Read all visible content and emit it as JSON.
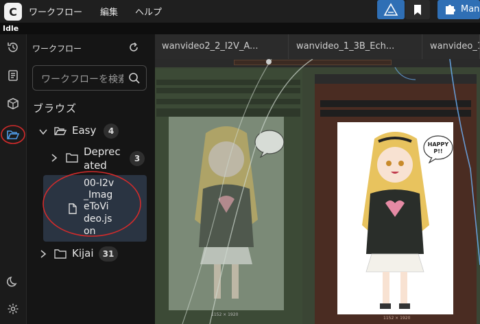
{
  "menu": {
    "workflow": "ワークフロー",
    "edit": "編集",
    "help": "ヘルプ"
  },
  "toolbar": {
    "manager_label": "Man"
  },
  "status": "Idle",
  "sidebar": {
    "title": "ワークフロー",
    "search_placeholder": "ワークフローを検索",
    "browse_heading": "ブラウズ",
    "tree": {
      "easy": {
        "label": "Easy",
        "count": "4"
      },
      "deprecated": {
        "label_line1": "Deprec",
        "label_line2": "ated",
        "count": "3"
      },
      "file": {
        "label": [
          "00-I2v",
          "_Imag",
          "eToVi",
          "deo.js",
          "on"
        ]
      },
      "kijai": {
        "label": "Kijai",
        "count": "31"
      }
    }
  },
  "tabs": [
    "wanvideo2_2_I2V_A...",
    "wanvideo_1_3B_Ech...",
    "wanvideo_1"
  ],
  "canvas": {
    "image_caption_left": "1152 × 1920",
    "image_caption_right": "1152 × 1920",
    "speech_bubble": "HAPPY\nP!!"
  },
  "colors": {
    "accent": "#2f6fb5",
    "annotation": "#d22b2b",
    "node_brown": "#4a2c22",
    "node_green": "#3c4a36"
  },
  "icons": [
    "history-icon",
    "queue-icon",
    "model-library-icon",
    "folder-open-icon",
    "moon-icon",
    "settings-icon",
    "refresh-icon",
    "search-icon",
    "bookmark-icon",
    "puzzle-icon"
  ]
}
